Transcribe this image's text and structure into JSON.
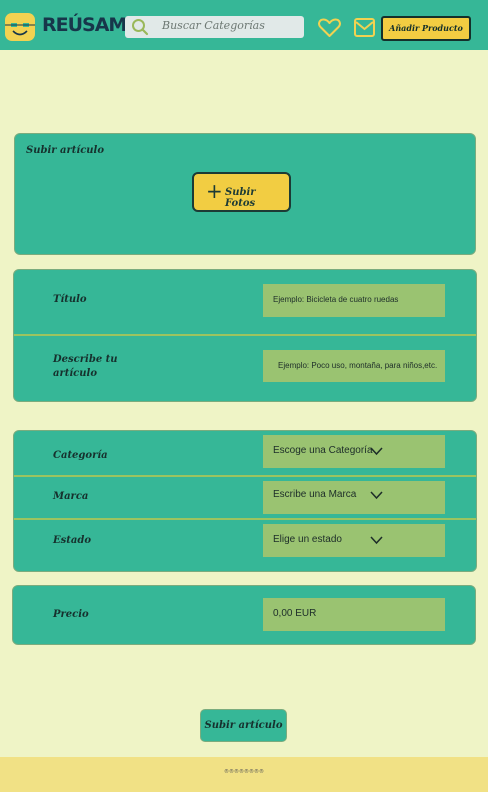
{
  "header": {
    "brand": "REÚSAME",
    "search_placeholder": "Buscar Categorías",
    "add_product_label": "Añadir Producto"
  },
  "upload": {
    "section_label": "Subir artículo",
    "upload_photos_label": "Subir Fotos"
  },
  "details": {
    "title_label": "Título",
    "title_placeholder": "Ejemplo: Bicicleta de cuatro ruedas",
    "description_label": "Describe tu artículo",
    "description_placeholder": "Ejemplo: Poco uso, montaña, para niños,etc."
  },
  "attributes": {
    "category_label": "Categoría",
    "category_value": "Escoge una Categoría",
    "brand_label": "Marca",
    "brand_value": "Escribe una Marca",
    "state_label": "Estado",
    "state_value": "Elige un estado"
  },
  "price": {
    "label": "Precio",
    "value": "0,00 EUR"
  },
  "submit_label": "Subir artículo",
  "footer": {
    "text": "®®®®®®®®"
  },
  "colors": {
    "header": "#36b797",
    "background": "#eff4c6",
    "panel": "#36b797",
    "field": "#9ac371",
    "button": "#f2cd42",
    "footer": "#f1e185"
  },
  "icons": [
    "logo-mark",
    "search-icon",
    "heart-icon",
    "mail-icon",
    "plus-icon",
    "chevron-down-icon"
  ]
}
